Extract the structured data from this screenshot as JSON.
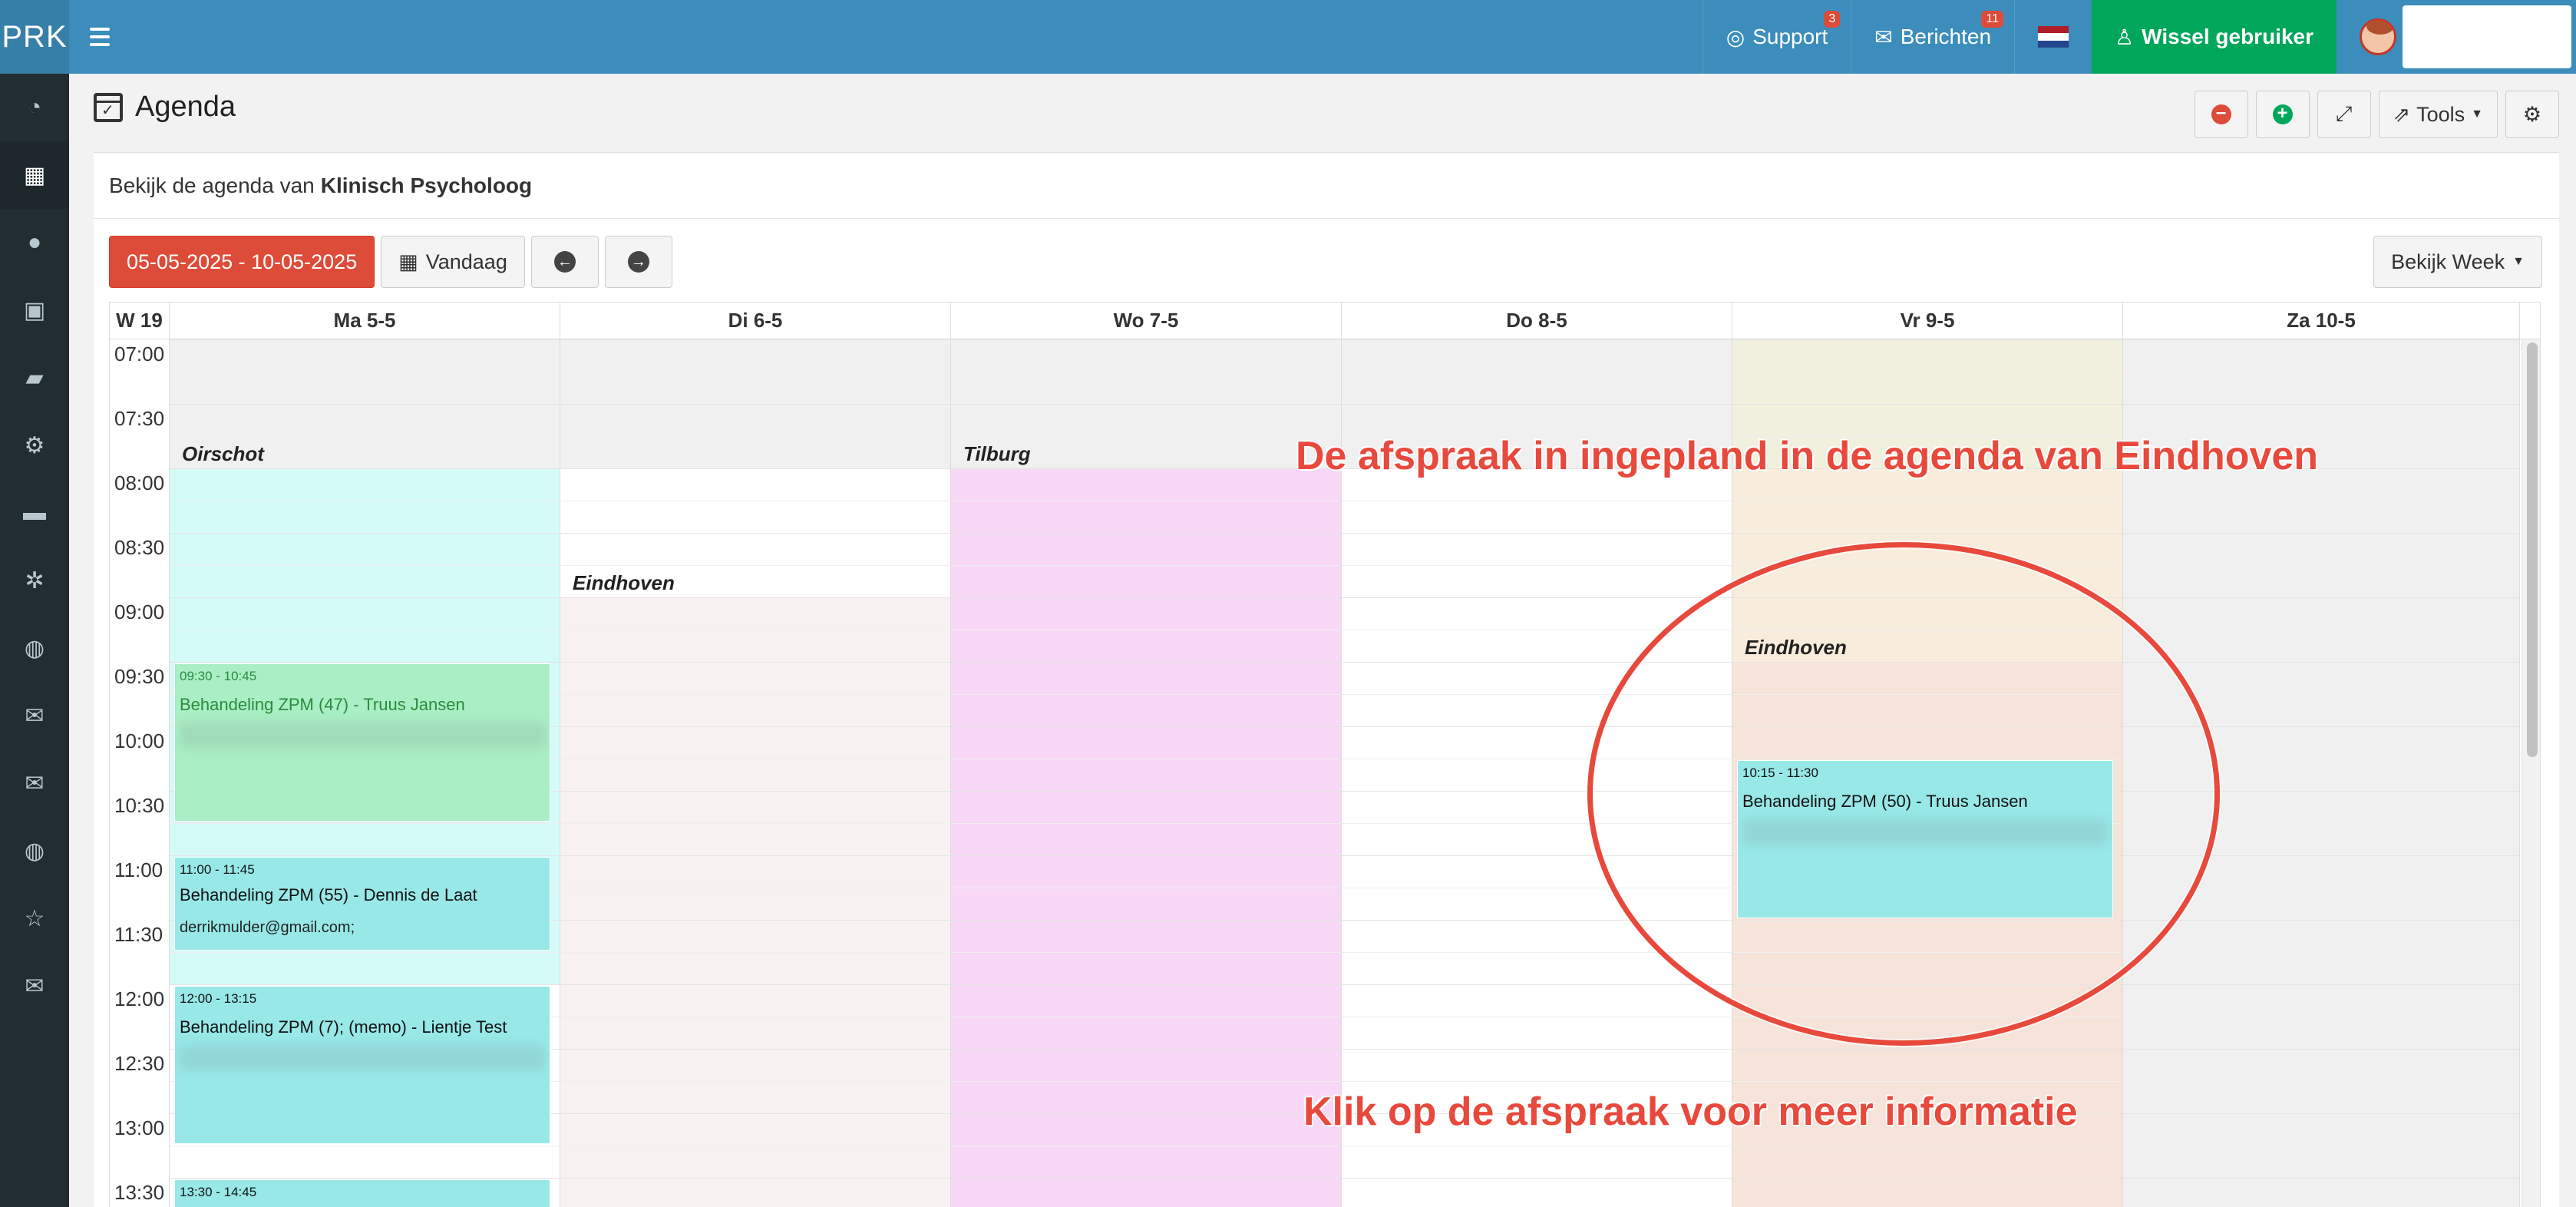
{
  "topbar": {
    "brand": "PRK",
    "support_label": "Support",
    "support_badge": "3",
    "messages_label": "Berichten",
    "messages_badge": "11",
    "switch_user_label": "Wissel gebruiker"
  },
  "sidebar": {
    "items": [
      {
        "icon": "dashboard-icon",
        "glyph": "◔"
      },
      {
        "icon": "calendar-icon",
        "glyph": "▦"
      },
      {
        "icon": "user-icon",
        "glyph": "●"
      },
      {
        "icon": "medkit-icon",
        "glyph": "▣"
      },
      {
        "icon": "book-icon",
        "glyph": "▰"
      },
      {
        "icon": "cogs-icon",
        "glyph": "⚙"
      },
      {
        "icon": "truck-icon",
        "glyph": "▬"
      },
      {
        "icon": "gear-icon",
        "glyph": "✲"
      },
      {
        "icon": "globe-icon",
        "glyph": "◍"
      },
      {
        "icon": "envelope-icon",
        "glyph": "✉"
      },
      {
        "icon": "envelope-open-icon",
        "glyph": "✉"
      },
      {
        "icon": "globe-2-icon",
        "glyph": "◍"
      },
      {
        "icon": "star-icon",
        "glyph": "☆"
      },
      {
        "icon": "mail-icon",
        "glyph": "✉"
      }
    ]
  },
  "page": {
    "title": "Agenda",
    "tools_label": "Tools"
  },
  "box": {
    "intro": "Bekijk de agenda van",
    "agenda_owner": "Klinisch Psycholoog",
    "date_range": "05-05-2025 - 10-05-2025",
    "today_label": "Vandaag",
    "view_label": "Bekijk Week"
  },
  "calendar": {
    "week_label": "W 19",
    "days": [
      "Ma 5-5",
      "Di 6-5",
      "Wo 7-5",
      "Do 8-5",
      "Vr 9-5",
      "Za 10-5"
    ],
    "times": [
      "07:00",
      "07:30",
      "08:00",
      "08:30",
      "09:00",
      "09:30",
      "10:00",
      "10:30",
      "11:00",
      "11:30",
      "12:00",
      "12:30",
      "13:00",
      "13:30"
    ],
    "locations": {
      "ma": "Oirschot",
      "di": "Eindhoven",
      "wo": "Tilburg",
      "vr": "Eindhoven"
    },
    "events": [
      {
        "time": "09:30 - 10:45",
        "title": "Behandeling ZPM (47) - Truus Jansen"
      },
      {
        "time": "11:00 - 11:45",
        "title": "Behandeling ZPM (55) - Dennis de Laat",
        "extra": "derrikmulder@gmail.com;"
      },
      {
        "time": "12:00 - 13:15",
        "title": "Behandeling ZPM (7); (memo) - Lientje Test"
      },
      {
        "time": "13:30 - 14:45",
        "title": ""
      },
      {
        "time": "10:15 - 11:30",
        "title": "Behandeling ZPM (50) - Truus Jansen"
      }
    ]
  },
  "annotations": {
    "top": "De afspraak in ingepland in de agenda van Eindhoven",
    "bottom": "Klik op de afspraak voor meer informatie",
    "color": "#e8493d"
  },
  "colors": {
    "header_blue": "#3c8dbc",
    "sidebar": "#222d32",
    "switch_green": "#00a65a",
    "date_red": "#dd4b39"
  }
}
